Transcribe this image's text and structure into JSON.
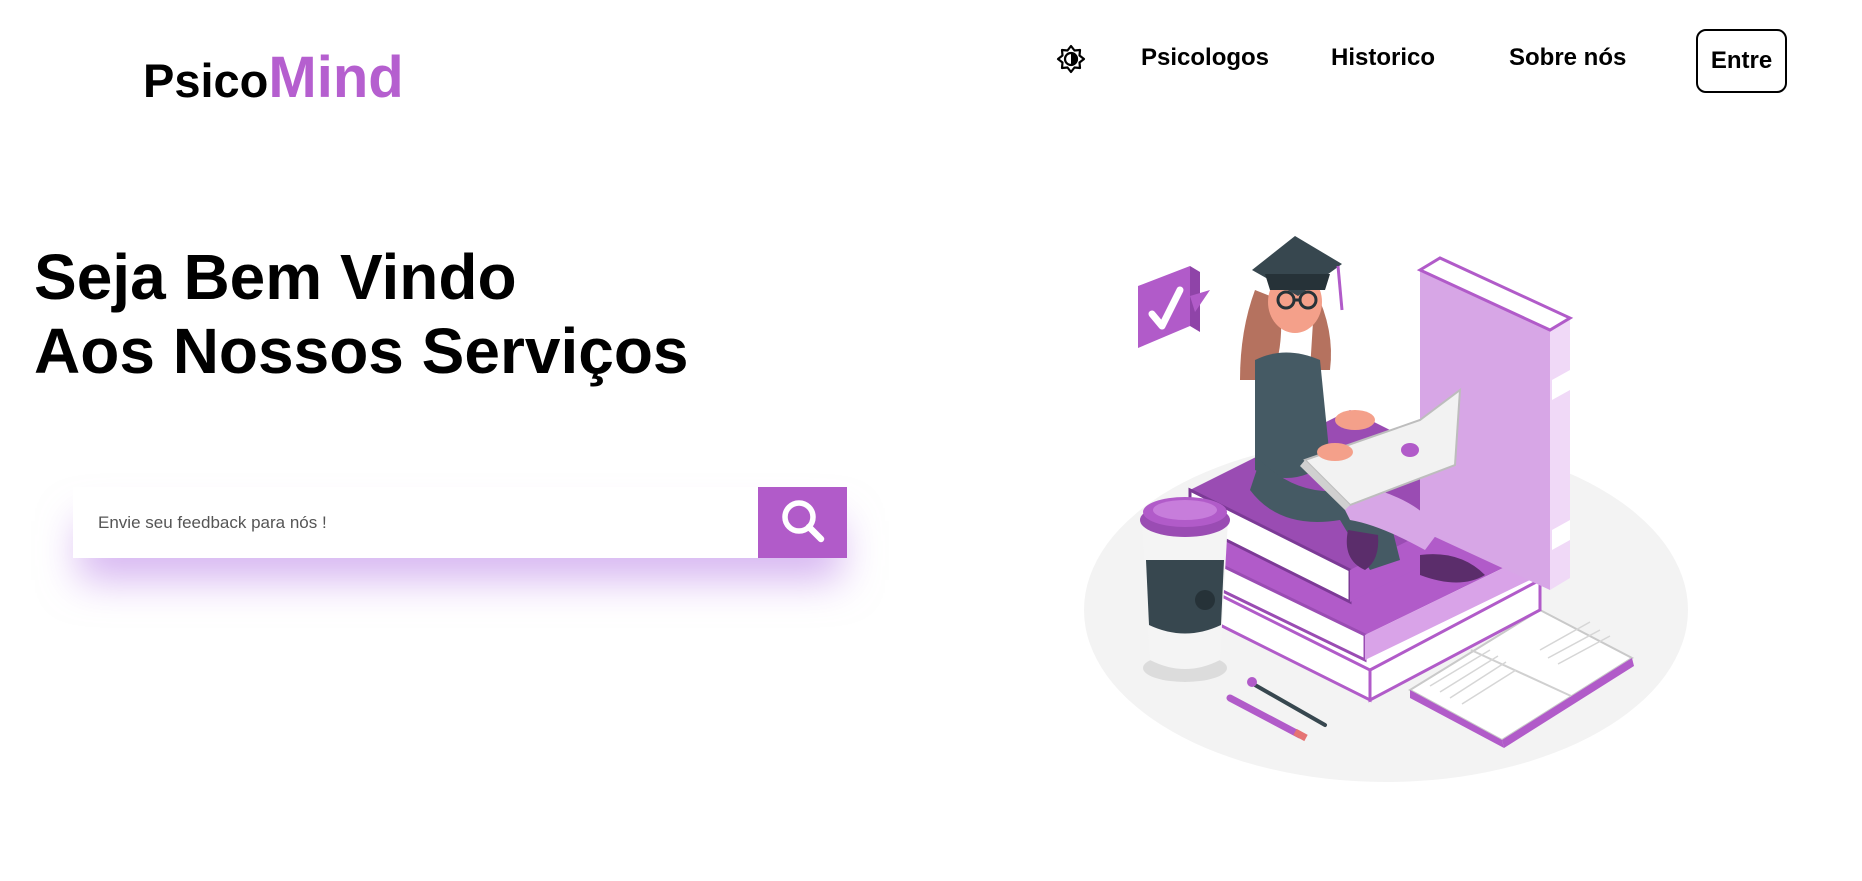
{
  "brand": {
    "part1": "Psico",
    "part2": "Mind"
  },
  "nav": {
    "theme_icon": "theme-toggle-icon",
    "links": [
      {
        "label": "Psicologos"
      },
      {
        "label": "Historico"
      },
      {
        "label": "Sobre nós"
      }
    ],
    "login_label": "Entre"
  },
  "hero": {
    "line1": "Seja Bem Vindo",
    "line2": "Aos Nossos Serviços"
  },
  "search": {
    "placeholder": "Envie seu feedback para nós !",
    "value": "",
    "button_icon": "search-icon"
  },
  "illustration": {
    "name": "student-studying-illustration"
  },
  "colors": {
    "accent": "#b55fcf",
    "button": "#b15bc9",
    "text": "#000000",
    "background": "#ffffff"
  }
}
